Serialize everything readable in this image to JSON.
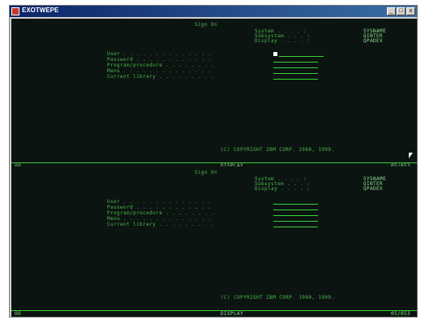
{
  "window": {
    "title": "EXOTWEPE",
    "buttons": {
      "minimize": "_",
      "maximize": "□",
      "close": "x"
    }
  },
  "sessions": [
    {
      "screen_title": "Sign On",
      "system_label": "System . . . . :",
      "system_value": "SYSNAME",
      "subsystem_label": "Subsystem . . . :",
      "subsystem_value": "QINTER",
      "display_label": "Display . . . . :",
      "display_value": "QPADEV",
      "fields": [
        "User . . . . . . . . . . . . . .",
        "Password . . . . . . . . . . . .",
        "Program/procedure . . . . . . . .",
        "Menu . . . . . . . . . . . . . .",
        "Current library . . . . . . . . ."
      ],
      "copyright": "(C) COPYRIGHT IBM CORP. 1980, 1999.",
      "status_left": "OO",
      "status_center": "DISPLAY",
      "status_right": "05/053"
    },
    {
      "screen_title": "Sign On",
      "system_label": "System . . . . :",
      "system_value": "SYSNAME",
      "subsystem_label": "Subsystem . . . :",
      "subsystem_value": "QINTER",
      "display_label": "Display . . . . :",
      "display_value": "QPADEV",
      "fields": [
        "User . . . . . . . . . . . . . .",
        "Password . . . . . . . . . . . .",
        "Program/procedure . . . . . . . .",
        "Menu . . . . . . . . . . . . . .",
        "Current library . . . . . . . . ."
      ],
      "copyright": "(C) COPYRIGHT IBM CORP. 1980, 1999.",
      "status_left": "OO",
      "status_center": "DISPLAY",
      "status_right": "05/053"
    }
  ]
}
